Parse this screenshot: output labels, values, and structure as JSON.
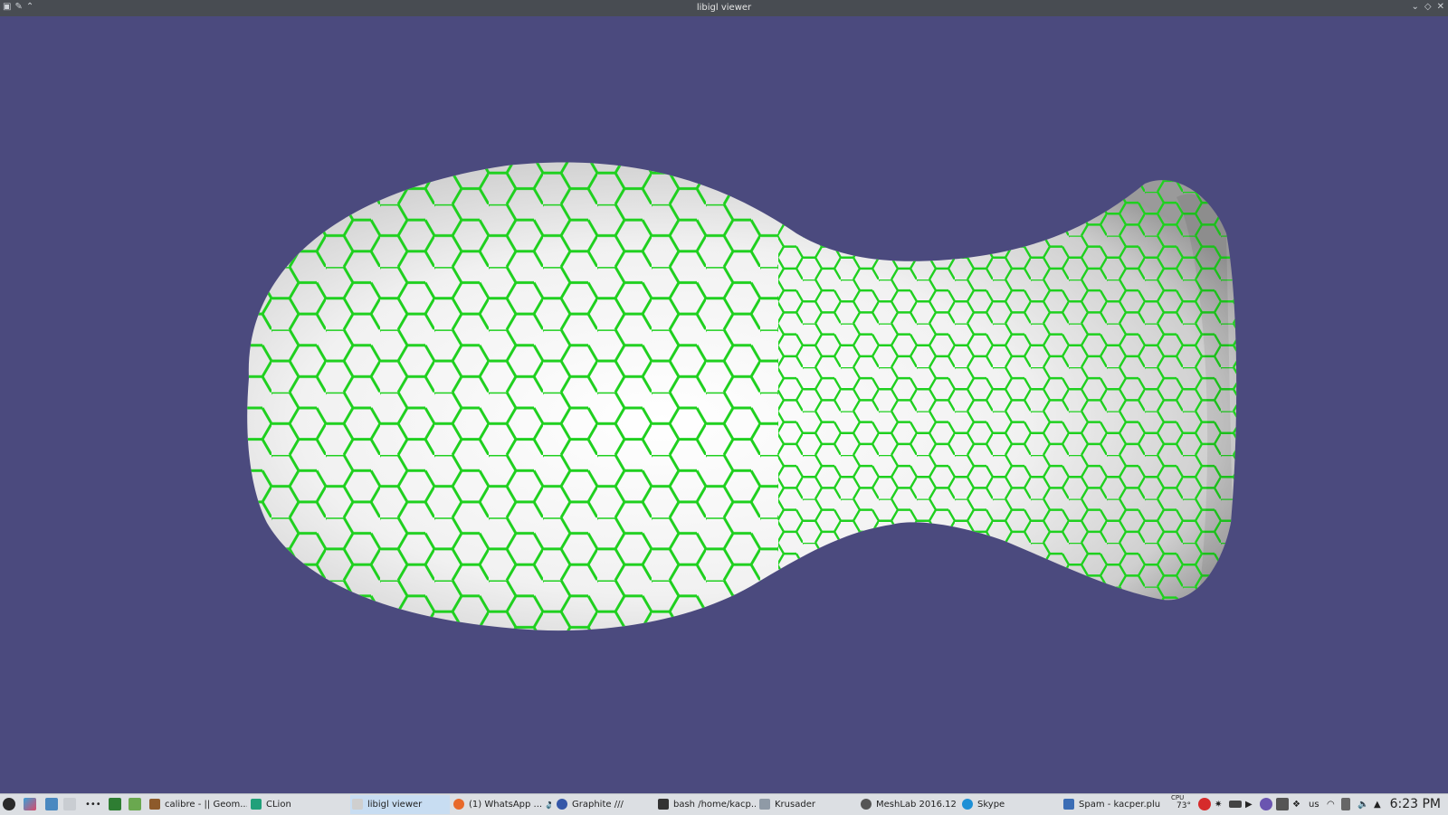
{
  "window": {
    "title": "libigl viewer"
  },
  "colors": {
    "background": "#4b4a7e",
    "mesh": "#f2f2f2",
    "hex_edges": "#1fd01f"
  },
  "taskbar": {
    "items": [
      {
        "label": "calibre - || Geom...",
        "icon": "calibre-icon"
      },
      {
        "label": "CLion",
        "icon": "clion-icon"
      },
      {
        "label": "libigl viewer",
        "icon": "x-window-icon",
        "active": true
      },
      {
        "label": "(1) WhatsApp ...",
        "icon": "firefox-icon"
      },
      {
        "label": "Graphite ///",
        "icon": "graphite-icon"
      },
      {
        "label": "bash  /home/kacp...",
        "icon": "terminal-icon"
      },
      {
        "label": "Krusader",
        "icon": "krusader-icon"
      },
      {
        "label": "MeshLab 2016.12",
        "icon": "meshlab-icon"
      },
      {
        "label": "Skype",
        "icon": "skype-icon"
      },
      {
        "label": "Spam - kacper.plu...",
        "icon": "mail-icon"
      }
    ],
    "cpu_label": "CPU",
    "cpu_temp": "73°",
    "keyboard_layout": "us",
    "clock": "6:23 PM"
  }
}
